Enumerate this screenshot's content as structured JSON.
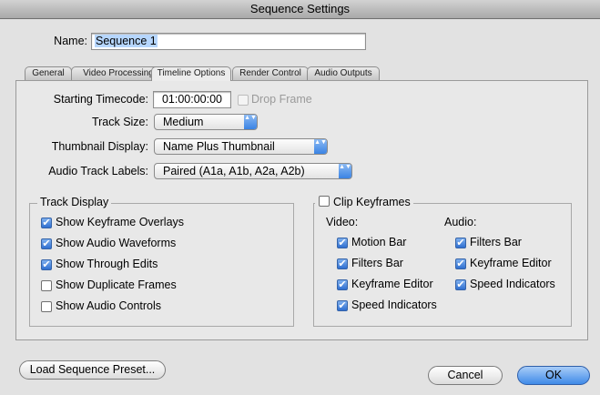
{
  "window": {
    "title": "Sequence Settings"
  },
  "name": {
    "label": "Name:",
    "value": "Sequence 1"
  },
  "tabs": [
    {
      "label": "General"
    },
    {
      "label": "Video Processing"
    },
    {
      "label": "Timeline Options",
      "active": true
    },
    {
      "label": "Render Control"
    },
    {
      "label": "Audio Outputs"
    }
  ],
  "timeline_options": {
    "starting_timecode": {
      "label": "Starting Timecode:",
      "value": "01:00:00:00"
    },
    "drop_frame": {
      "label": "Drop Frame",
      "checked": false,
      "enabled": false
    },
    "track_size": {
      "label": "Track Size:",
      "value": "Medium"
    },
    "thumbnail_display": {
      "label": "Thumbnail Display:",
      "value": "Name Plus Thumbnail"
    },
    "audio_track_labels": {
      "label": "Audio Track Labels:",
      "value": "Paired (A1a, A1b, A2a, A2b)"
    }
  },
  "track_display": {
    "title": "Track Display",
    "items": [
      {
        "label": "Show Keyframe Overlays",
        "checked": true
      },
      {
        "label": "Show Audio Waveforms",
        "checked": true
      },
      {
        "label": "Show Through Edits",
        "checked": true
      },
      {
        "label": "Show Duplicate Frames",
        "checked": false
      },
      {
        "label": "Show Audio Controls",
        "checked": false
      }
    ]
  },
  "clip_keyframes": {
    "title": "Clip Keyframes",
    "checked": false,
    "video_label": "Video:",
    "audio_label": "Audio:",
    "video_items": [
      {
        "label": "Motion Bar",
        "checked": true
      },
      {
        "label": "Filters Bar",
        "checked": true
      },
      {
        "label": "Keyframe Editor",
        "checked": true
      },
      {
        "label": "Speed Indicators",
        "checked": true
      }
    ],
    "audio_items": [
      {
        "label": "Filters Bar",
        "checked": true
      },
      {
        "label": "Keyframe Editor",
        "checked": true
      },
      {
        "label": "Speed Indicators",
        "checked": true
      }
    ]
  },
  "buttons": {
    "load_preset": "Load Sequence Preset...",
    "cancel": "Cancel",
    "ok": "OK"
  },
  "glyphs": {
    "check": "✔",
    "popup_arrows": "▲▼"
  }
}
